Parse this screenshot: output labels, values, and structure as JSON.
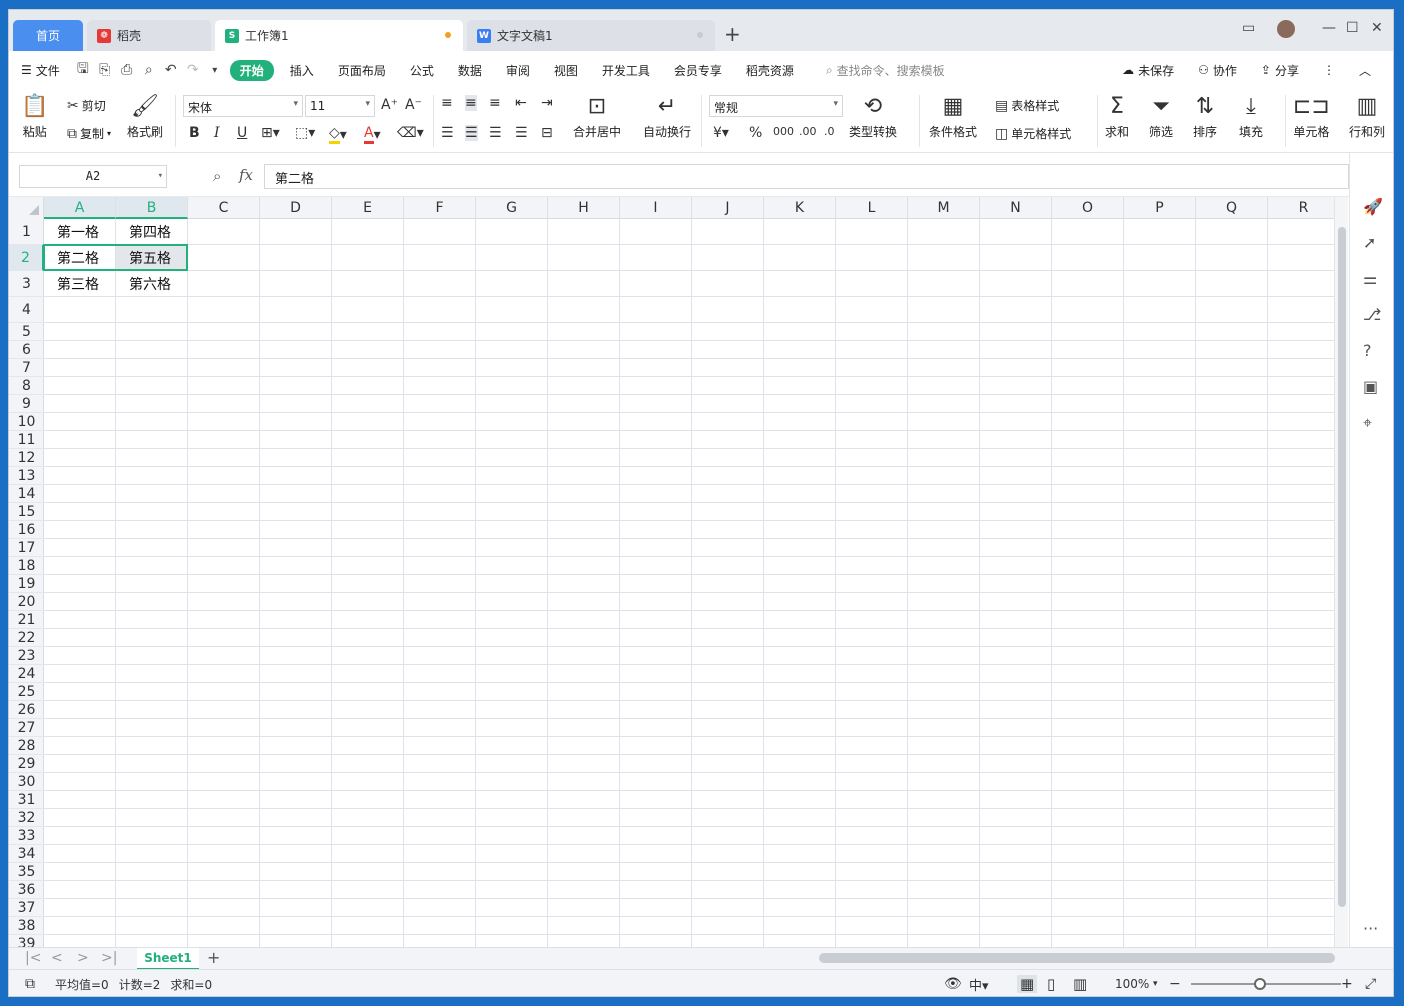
{
  "tabs": {
    "home": "首页",
    "daoke": "稻壳",
    "workbook": "工作簿1",
    "document": "文字文稿1"
  },
  "menu": {
    "file": "文件",
    "items": [
      "开始",
      "插入",
      "页面布局",
      "公式",
      "数据",
      "审阅",
      "视图",
      "开发工具",
      "会员专享",
      "稻壳资源"
    ],
    "search": "查找命令、搜索模板",
    "unsaved": "未保存",
    "collab": "协作",
    "share": "分享"
  },
  "ribbon": {
    "paste": "粘贴",
    "cut": "剪切",
    "copy": "复制",
    "format_painter": "格式刷",
    "font": "宋体",
    "font_size": "11",
    "merge": "合并居中",
    "wrap": "自动换行",
    "number_format": "常规",
    "type_convert": "类型转换",
    "cond_format": "条件格式",
    "table_style": "表格样式",
    "cell_style": "单元格样式",
    "sum": "求和",
    "filter": "筛选",
    "sort": "排序",
    "fill": "填充",
    "cell": "单元格",
    "rowcol": "行和列"
  },
  "formula_bar": {
    "name_box": "A2",
    "fx": "fx",
    "value": "第二格"
  },
  "columns": [
    "A",
    "B",
    "C",
    "D",
    "E",
    "F",
    "G",
    "H",
    "I",
    "J",
    "K",
    "L",
    "M",
    "N",
    "O",
    "P",
    "Q",
    "R"
  ],
  "rows": [
    "1",
    "2",
    "3",
    "4",
    "5",
    "6",
    "7",
    "8",
    "9",
    "10",
    "11",
    "12",
    "13",
    "14",
    "15",
    "16",
    "17",
    "18",
    "19",
    "20",
    "21",
    "22",
    "23",
    "24",
    "25",
    "26",
    "27",
    "28",
    "29",
    "30",
    "31",
    "32",
    "33",
    "34",
    "35",
    "36",
    "37",
    "38",
    "39"
  ],
  "cells": {
    "A1": "第一格",
    "B1": "第四格",
    "A2": "第二格",
    "B2": "第五格",
    "A3": "第三格",
    "B3": "第六格"
  },
  "sheet": {
    "name": "Sheet1"
  },
  "status": {
    "average": "平均值=0",
    "count": "计数=2",
    "sum": "求和=0",
    "zoom": "100%"
  },
  "colors": {
    "accent": "#22b07d",
    "home_tab": "#4a8ef0",
    "desktop": "#1a6fc4"
  }
}
